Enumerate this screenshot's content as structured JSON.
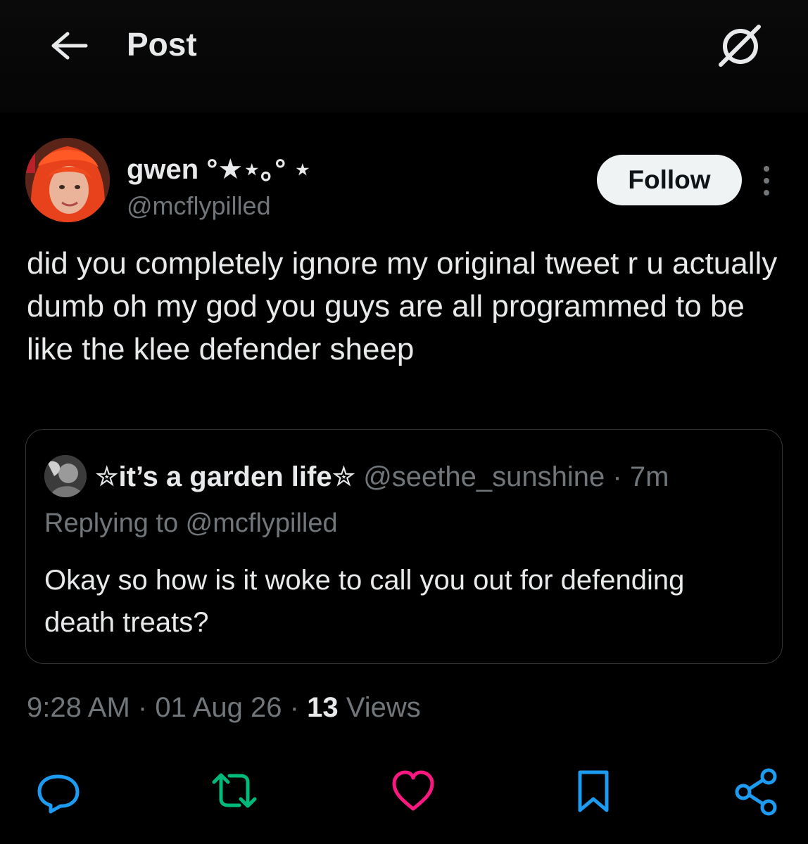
{
  "header": {
    "title": "Post",
    "back_icon": "arrow-left-icon",
    "grok_icon": "grok-icon"
  },
  "post": {
    "display_name": "gwen °★⋆｡° ⋆",
    "handle": "@mcflypilled",
    "follow_label": "Follow",
    "text": "did you completely ignore my original tweet r u actually dumb oh my god you guys are all programmed to be like the klee defender sheep",
    "time": "9:28 AM",
    "date": "01 Aug 26",
    "views_count": "13",
    "views_label": "Views",
    "separator": "·"
  },
  "quote": {
    "display_name": "✮it’s a garden life✮",
    "handle": "@seethe_sunshine",
    "separator": "·",
    "time_ago": "7m",
    "replying_to": "Replying to @mcflypilled",
    "text": "Okay so how is it woke to call you out for defending death treats?"
  },
  "actions": {
    "reply_icon": "reply-icon",
    "repost_icon": "repost-icon",
    "like_icon": "heart-icon",
    "bookmark_icon": "bookmark-icon",
    "share_icon": "share-icon"
  },
  "colors": {
    "background": "#000000",
    "text_primary": "#e7e9ea",
    "text_secondary": "#71767b",
    "follow_bg": "#eff3f4",
    "border": "#333639"
  }
}
